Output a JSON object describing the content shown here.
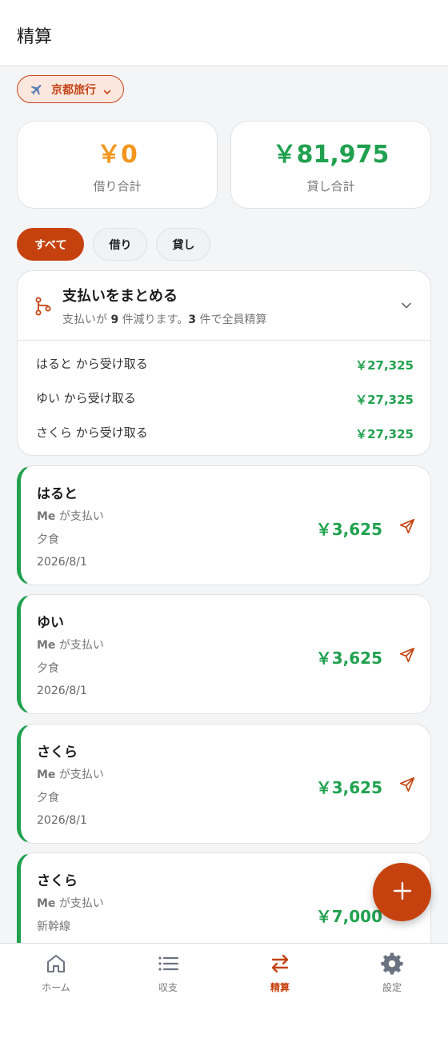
{
  "header": {
    "title": "精算"
  },
  "trip": {
    "name": "京都旅行"
  },
  "summary": {
    "borrow": {
      "value": "￥0",
      "label": "借り合計"
    },
    "lend": {
      "value": "￥81,975",
      "label": "貸し合計"
    }
  },
  "filters": [
    "すべて",
    "借り",
    "貸し"
  ],
  "merge": {
    "title": "支払いをまとめる",
    "subtitle_pre": "支払いが",
    "subtitle_count1": "9",
    "subtitle_mid": "件減ります。",
    "subtitle_count2": "3",
    "subtitle_post": "件で全員精算",
    "rows": [
      {
        "who": "はると から受け取る",
        "amount": "￥27,325"
      },
      {
        "who": "ゆい から受け取る",
        "amount": "￥27,325"
      },
      {
        "who": "さくら から受け取る",
        "amount": "￥27,325"
      }
    ]
  },
  "transactions": [
    {
      "name": "はると",
      "payer": "Me",
      "payer_suffix": "が支払い",
      "desc": "夕食",
      "date": "2026/8/1",
      "amount": "￥3,625"
    },
    {
      "name": "ゆい",
      "payer": "Me",
      "payer_suffix": "が支払い",
      "desc": "夕食",
      "date": "2026/8/1",
      "amount": "￥3,625"
    },
    {
      "name": "さくら",
      "payer": "Me",
      "payer_suffix": "が支払い",
      "desc": "夕食",
      "date": "2026/8/1",
      "amount": "￥3,625"
    },
    {
      "name": "さくら",
      "payer": "Me",
      "payer_suffix": "が支払い",
      "desc": "新幹線",
      "date": "",
      "amount": "￥7,000"
    }
  ],
  "nav": [
    {
      "label": "ホーム",
      "icon": "home-icon"
    },
    {
      "label": "収支",
      "icon": "list-icon"
    },
    {
      "label": "精算",
      "icon": "swap-icon"
    },
    {
      "label": "設定",
      "icon": "gear-icon"
    }
  ],
  "colors": {
    "accent": "#c5420f",
    "green": "#21a150",
    "orange": "#f2961e"
  }
}
